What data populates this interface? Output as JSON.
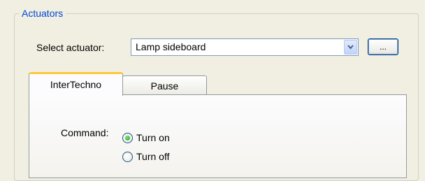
{
  "group": {
    "title": "Actuators"
  },
  "actuator_select": {
    "label": "Select actuator:",
    "value": "Lamp sideboard",
    "browse_label": "..."
  },
  "tabs": [
    {
      "label": "InterTechno",
      "selected": true
    },
    {
      "label": "Pause",
      "selected": false
    }
  ],
  "command": {
    "label": "Command:",
    "options": [
      {
        "label": "Turn on",
        "checked": true
      },
      {
        "label": "Turn off",
        "checked": false
      }
    ]
  },
  "colors": {
    "window_bg": "#f1efe2",
    "legend_text": "#0046d5",
    "active_tab_highlight": "#ffc83c",
    "radio_selected": "#21a121"
  }
}
